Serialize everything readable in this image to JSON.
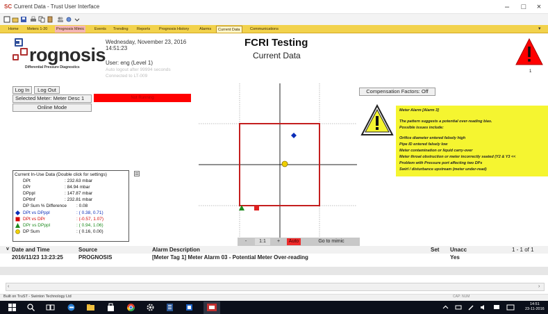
{
  "window": {
    "app_icon": "SC",
    "title": "Current Data - Trust User Interface",
    "minimize": "–",
    "maximize": "□",
    "close": "×"
  },
  "tabs": [
    "Home",
    "Meters 1-20",
    "Prognosis Mimic",
    "Events",
    "Trending",
    "Reports",
    "Prognosis History",
    "Alarms",
    "Current Data",
    "Communications"
  ],
  "active_tab": "Current Data",
  "header": {
    "logo_text": "rognosis",
    "logo_sub": "Differential Pressure Diagnostics",
    "date": "Wednesday, November 23, 2016",
    "time": "14:51:23",
    "user": "User: eng (Level 1)",
    "autologout": "Auto logout after 99994 seconds",
    "connected": "Connected to LT-009",
    "title": "FCRI Testing",
    "subtitle": "Current Data",
    "alarm_count": "1"
  },
  "left_panel": {
    "login": "Log In",
    "logout": "Log Out",
    "selected_meter": "Selected Meter: Meter Desc 1",
    "meter_state": "Not Running",
    "online_mode": "Online Mode"
  },
  "current_data": {
    "title": "Current In-Use Data (Double click for settings)",
    "rows": [
      {
        "label": "DPt",
        "value": "232.63 mbar"
      },
      {
        "label": "DPr",
        "value": "84.94 mbar"
      },
      {
        "label": "DPppl",
        "value": "147.87 mbar"
      },
      {
        "label": "DPtlnf",
        "value": "232.81 mbar"
      },
      {
        "label": "DP Sum % Difference",
        "value": "0.08"
      }
    ],
    "points": [
      {
        "label": "DPt vs DPppl",
        "value": "( 0.38, 0.71)",
        "color": "#0b2db8"
      },
      {
        "label": "DPt vs DPr",
        "value": "(-0.57, 1.07)",
        "color": "#d40000"
      },
      {
        "label": "DPr vs DPppl",
        "value": "( 0.94, 1.06)",
        "color": "#1d8a1d"
      },
      {
        "label": "DP Sum",
        "value": "( 0.16, 0.00)",
        "color": "#d4b800"
      }
    ]
  },
  "chart_controls": {
    "minus": "-",
    "scale": "1:1",
    "plus": "+",
    "auto": "Auto",
    "goto": "Go to mimic"
  },
  "right_panel": {
    "comp_factors": "Compensation Factors: Off",
    "alarm_title": "Meter Alarm [Alarm 3]",
    "alarm_desc": "The pattern suggests a potential over-reading bias.",
    "issues_title": "Possible issues include:",
    "issues": [
      "Orifice diameter entered falsely high",
      "Pipe ID entered falsely low",
      "Meter contamination or liquid carry-over",
      "Meter throat obstruction or meter incorrectly seated (Y2 & Y3 <<",
      "Problem with Pressure port affecting two DPs",
      "Swirl / disturbance upstream (meter under-read)"
    ]
  },
  "alarm_list": {
    "headers": {
      "date": "Date and Time",
      "source": "Source",
      "description": "Alarm Description",
      "set": "Set",
      "unacc": "Unacc",
      "count": "1 - 1 of 1"
    },
    "rows": [
      {
        "date": "2016/11/23 13:23:25",
        "source": "PROGNOSIS",
        "description": "[Meter Tag 1] Meter Alarm 03 - Potential Meter Over-reading",
        "set": "",
        "unacc": "Yes"
      }
    ]
  },
  "status": {
    "left": "Built on TruST - Swinton Technology Ltd",
    "right": "CAP: NUM"
  },
  "taskbar": {
    "time": "14:51",
    "date": "23-11-2016"
  }
}
